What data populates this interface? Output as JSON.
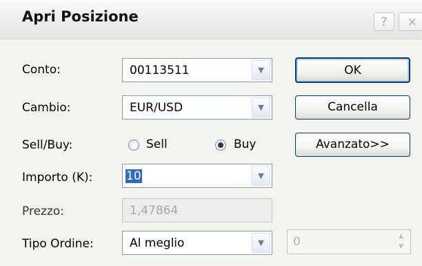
{
  "window": {
    "title": "Apri Posizione",
    "help_label": "?",
    "close_label": "×"
  },
  "form": {
    "conto": {
      "label": "Conto:",
      "value": "00113511"
    },
    "cambio": {
      "label": "Cambio:",
      "value": "EUR/USD"
    },
    "side": {
      "label": "Sell/Buy:",
      "sell": "Sell",
      "buy": "Buy",
      "selected": "Buy"
    },
    "importo": {
      "label": "Importo (K):",
      "value": "10"
    },
    "prezzo": {
      "label": "Prezzo:",
      "value": "1,47864"
    },
    "tipo": {
      "label": "Tipo Ordine:",
      "value": "Al meglio"
    },
    "limit": {
      "value": "0"
    }
  },
  "buttons": {
    "ok": "OK",
    "cancel": "Cancella",
    "advanced": "Avanzato>>"
  },
  "icons": {
    "dropdown": "chevron-down-icon",
    "spin_up": "chevron-up-icon",
    "spin_down": "chevron-down-icon"
  }
}
